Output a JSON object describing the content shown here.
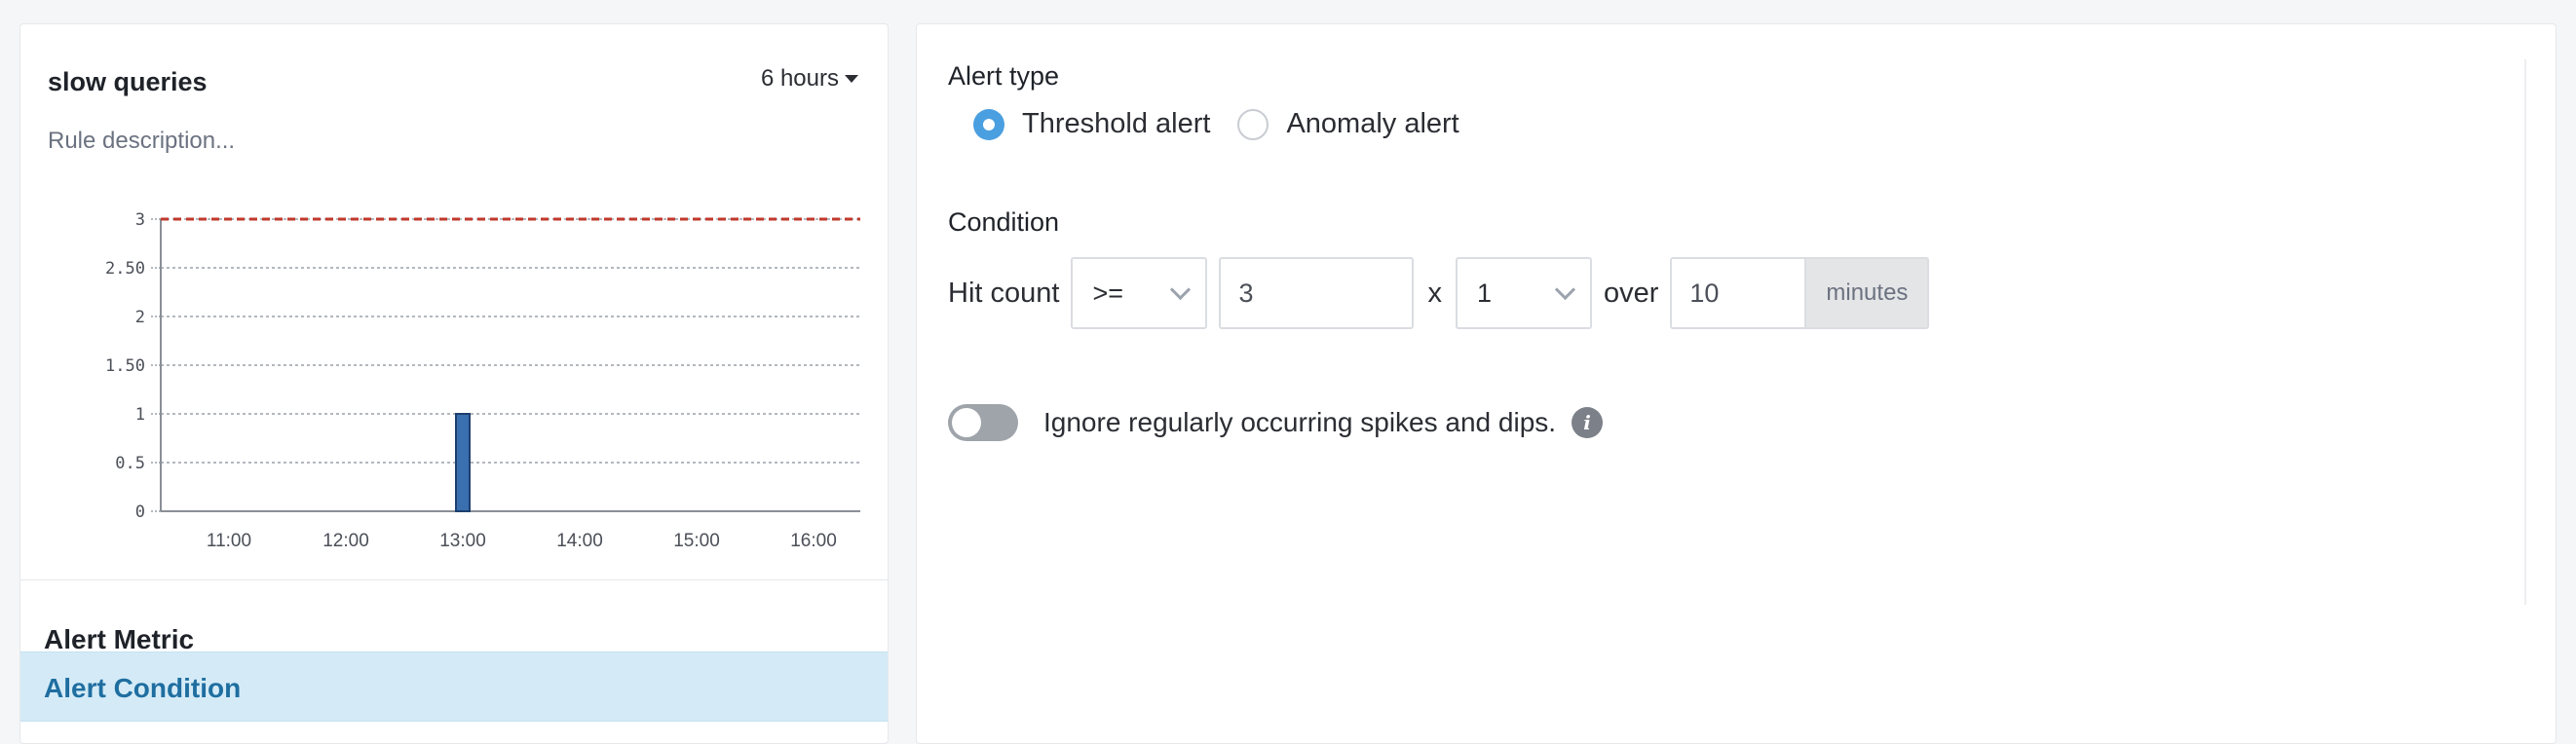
{
  "rule_panel": {
    "title": "slow queries",
    "time_range": "6 hours",
    "description_placeholder": "Rule description..."
  },
  "chart_data": {
    "type": "bar",
    "x": [
      "13:00"
    ],
    "values": [
      1
    ],
    "threshold": 3,
    "threshold_color": "#c0392b",
    "bar_color": "#3a6fb0",
    "xticks": [
      "11:00",
      "12:00",
      "13:00",
      "14:00",
      "15:00",
      "16:00"
    ],
    "yticks": [
      "0",
      "0.5",
      "1",
      "1.50",
      "2",
      "2.50",
      "3"
    ],
    "ylim": [
      0,
      3
    ],
    "grid": true
  },
  "nav": {
    "alert_metric": "Alert Metric",
    "alert_condition": "Alert Condition"
  },
  "alert_type": {
    "label": "Alert type",
    "options": [
      {
        "label": "Threshold alert",
        "selected": true
      },
      {
        "label": "Anomaly alert",
        "selected": false
      }
    ]
  },
  "condition": {
    "label": "Condition",
    "metric_label": "Hit count",
    "operator": ">=",
    "value": "3",
    "times_label": "x",
    "multiplier": "1",
    "over_label": "over",
    "window": "10",
    "window_unit": "minutes"
  },
  "ignore_spikes": {
    "enabled": false,
    "label": "Ignore regularly occurring spikes and dips.",
    "info_icon": "info-icon"
  },
  "colors": {
    "accent": "#4a9fe0",
    "selected_nav_bg": "#d4ebf7",
    "selected_nav_text": "#1f6ea0"
  }
}
